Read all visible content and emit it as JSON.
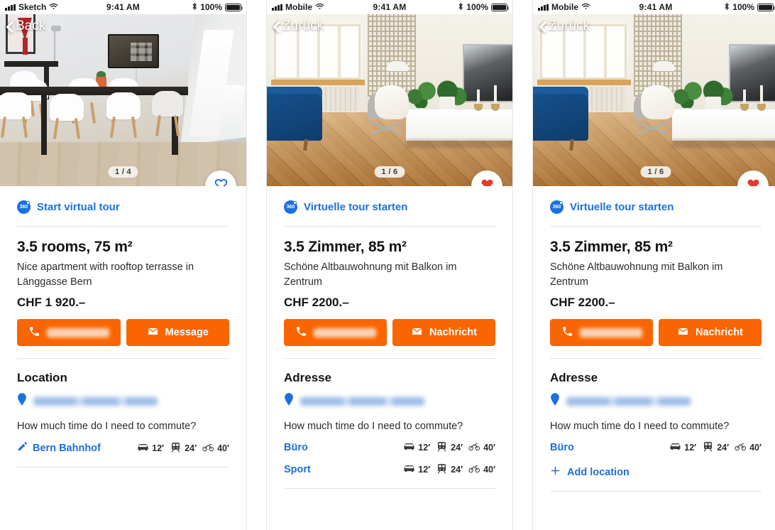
{
  "app": {
    "accent_blue": "#1b70e0",
    "accent_orange": "#f96500",
    "heart_red": "#e8392c"
  },
  "panels": [
    {
      "id": "panel-en",
      "status_bar": {
        "carrier": "Sketch",
        "time": "9:41 AM",
        "battery": "100%"
      },
      "back_label": "Back",
      "photo_counter": "1 / 4",
      "favorite_state": "outline",
      "virtual_tour": {
        "badge": "360",
        "label": "Start virtual tour"
      },
      "listing": {
        "title": "3.5 rooms, 75 m²",
        "subtitle": "Nice apartment with rooftop terrasse in Länggasse Bern",
        "price": "CHF 1 920.–"
      },
      "actions": {
        "call_label": "",
        "message_label": "Message"
      },
      "location": {
        "heading": "Location",
        "address": "",
        "question": "How much time do I need to commute?",
        "rows": [
          {
            "name": "Bern Bahnhof",
            "editable": true,
            "times": [
              {
                "mode": "car",
                "value": "12′"
              },
              {
                "mode": "train",
                "value": "24′"
              },
              {
                "mode": "bike",
                "value": "40′"
              }
            ]
          }
        ],
        "add_location_label": ""
      }
    },
    {
      "id": "panel-de-1",
      "status_bar": {
        "carrier": "Mobile",
        "time": "9:41 AM",
        "battery": "100%"
      },
      "back_label": "Zurück",
      "photo_counter": "1 / 6",
      "favorite_state": "filled",
      "virtual_tour": {
        "badge": "360",
        "label": "Virtuelle tour starten"
      },
      "listing": {
        "title": "3.5 Zimmer, 85 m²",
        "subtitle": "Schöne Altbauwohnung mit Balkon im Zentrum",
        "price": "CHF 2200.–"
      },
      "actions": {
        "call_label": "",
        "message_label": "Nachricht"
      },
      "location": {
        "heading": "Adresse",
        "address": "",
        "question": "How much time do I need to commute?",
        "rows": [
          {
            "name": "Büro",
            "editable": false,
            "times": [
              {
                "mode": "car",
                "value": "12′"
              },
              {
                "mode": "train",
                "value": "24′"
              },
              {
                "mode": "bike",
                "value": "40′"
              }
            ]
          },
          {
            "name": "Sport",
            "editable": false,
            "times": [
              {
                "mode": "car",
                "value": "12′"
              },
              {
                "mode": "train",
                "value": "24′"
              },
              {
                "mode": "bike",
                "value": "40′"
              }
            ]
          }
        ],
        "add_location_label": ""
      }
    },
    {
      "id": "panel-de-2",
      "status_bar": {
        "carrier": "Mobile",
        "time": "9:41 AM",
        "battery": "100%"
      },
      "back_label": "Zurück",
      "photo_counter": "1 / 6",
      "favorite_state": "filled",
      "virtual_tour": {
        "badge": "360",
        "label": "Virtuelle tour starten"
      },
      "listing": {
        "title": "3.5 Zimmer, 85 m²",
        "subtitle": "Schöne Altbauwohnung mit Balkon im Zentrum",
        "price": "CHF 2200.–"
      },
      "actions": {
        "call_label": "",
        "message_label": "Nachricht"
      },
      "location": {
        "heading": "Adresse",
        "address": "",
        "question": "How much time do I need to commute?",
        "rows": [
          {
            "name": "Büro",
            "editable": false,
            "times": [
              {
                "mode": "car",
                "value": "12′"
              },
              {
                "mode": "train",
                "value": "24′"
              },
              {
                "mode": "bike",
                "value": "40′"
              }
            ]
          }
        ],
        "add_location_label": "Add location"
      }
    }
  ]
}
